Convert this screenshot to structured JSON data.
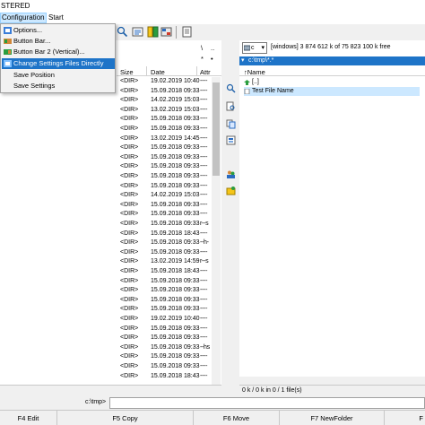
{
  "window": {
    "title": "STERED"
  },
  "menubar": {
    "configuration": "Configuration",
    "start": "Start"
  },
  "config_menu": {
    "items": [
      {
        "label": "Options..."
      },
      {
        "label": "Button Bar..."
      },
      {
        "label": "Button Bar 2 (Vertical)..."
      },
      {
        "label": "Change Settings Files Directly"
      },
      {
        "label": "Save Position"
      },
      {
        "label": "Save Settings"
      }
    ]
  },
  "left_panel": {
    "nav": {
      "back": "\\",
      "up": "..",
      "star": "*",
      "dot": "•"
    },
    "columns": {
      "size": "Size",
      "date": "Date",
      "attr": "Attr"
    },
    "rows": [
      {
        "size": "<DIR>",
        "date": "19.02.2019 10:40",
        "attr": "----"
      },
      {
        "size": "<DIR>",
        "date": "15.09.2018 09:33",
        "attr": "----"
      },
      {
        "size": "<DIR>",
        "date": "14.02.2019 15:03",
        "attr": "----"
      },
      {
        "size": "<DIR>",
        "date": "13.02.2019 15:03",
        "attr": "----"
      },
      {
        "size": "<DIR>",
        "date": "15.09.2018 09:33",
        "attr": "----"
      },
      {
        "size": "<DIR>",
        "date": "15.09.2018 09:33",
        "attr": "----"
      },
      {
        "size": "<DIR>",
        "date": "13.02.2019 14:45",
        "attr": "----"
      },
      {
        "size": "<DIR>",
        "date": "15.09.2018 09:33",
        "attr": "----"
      },
      {
        "size": "<DIR>",
        "date": "15.09.2018 09:33",
        "attr": "----"
      },
      {
        "size": "<DIR>",
        "date": "15.09.2018 09:33",
        "attr": "----"
      },
      {
        "size": "<DIR>",
        "date": "15.09.2018 09:33",
        "attr": "----"
      },
      {
        "size": "<DIR>",
        "date": "15.09.2018 09:33",
        "attr": "----"
      },
      {
        "size": "<DIR>",
        "date": "14.02.2019 15:03",
        "attr": "----"
      },
      {
        "size": "<DIR>",
        "date": "15.09.2018 09:33",
        "attr": "----"
      },
      {
        "size": "<DIR>",
        "date": "15.09.2018 09:33",
        "attr": "----"
      },
      {
        "size": "<DIR>",
        "date": "15.09.2018 09:33",
        "attr": "r--s"
      },
      {
        "size": "<DIR>",
        "date": "15.09.2018 18:43",
        "attr": "----"
      },
      {
        "size": "<DIR>",
        "date": "15.09.2018 09:33",
        "attr": "--h-"
      },
      {
        "size": "<DIR>",
        "date": "15.09.2018 09:33",
        "attr": "----"
      },
      {
        "size": "<DIR>",
        "date": "13.02.2019 14:59",
        "attr": "r--s"
      },
      {
        "size": "<DIR>",
        "date": "15.09.2018 18:43",
        "attr": "----"
      },
      {
        "size": "<DIR>",
        "date": "15.09.2018 09:33",
        "attr": "----"
      },
      {
        "size": "<DIR>",
        "date": "15.09.2018 09:33",
        "attr": "----"
      },
      {
        "size": "<DIR>",
        "date": "15.09.2018 09:33",
        "attr": "----"
      },
      {
        "size": "<DIR>",
        "date": "15.09.2018 09:33",
        "attr": "----"
      },
      {
        "size": "<DIR>",
        "date": "19.02.2019 10:40",
        "attr": "----"
      },
      {
        "size": "<DIR>",
        "date": "15.09.2018 09:33",
        "attr": "----"
      },
      {
        "size": "<DIR>",
        "date": "15.09.2018 09:33",
        "attr": "----"
      },
      {
        "size": "<DIR>",
        "date": "15.09.2018 09:33",
        "attr": "--hs"
      },
      {
        "size": "<DIR>",
        "date": "15.09.2018 09:33",
        "attr": "----"
      },
      {
        "size": "<DIR>",
        "date": "15.09.2018 09:33",
        "attr": "----"
      },
      {
        "size": "<DIR>",
        "date": "15.09.2018 18:43",
        "attr": "----"
      }
    ]
  },
  "right_panel": {
    "drive": "c",
    "drive_info": "[windows]  3 874 612 k of 75 823 100 k free",
    "path": "c:\\tmp\\*.*",
    "column_name": "↑Name",
    "rows": [
      {
        "label": "[..]"
      },
      {
        "label": "Test File Name"
      }
    ],
    "status": "0 k / 0 k in 0 / 1 file(s)"
  },
  "command_line": {
    "label": "c:\\tmp>",
    "value": ""
  },
  "function_keys": [
    {
      "label": "F4 Edit"
    },
    {
      "label": "F5 Copy"
    },
    {
      "label": "F6 Move"
    },
    {
      "label": "F7 NewFolder"
    },
    {
      "label": "F"
    }
  ],
  "colors": {
    "selection": "#1e74c8",
    "menu_hover": "#cce8ff",
    "row_highlight": "#cce8ff"
  }
}
